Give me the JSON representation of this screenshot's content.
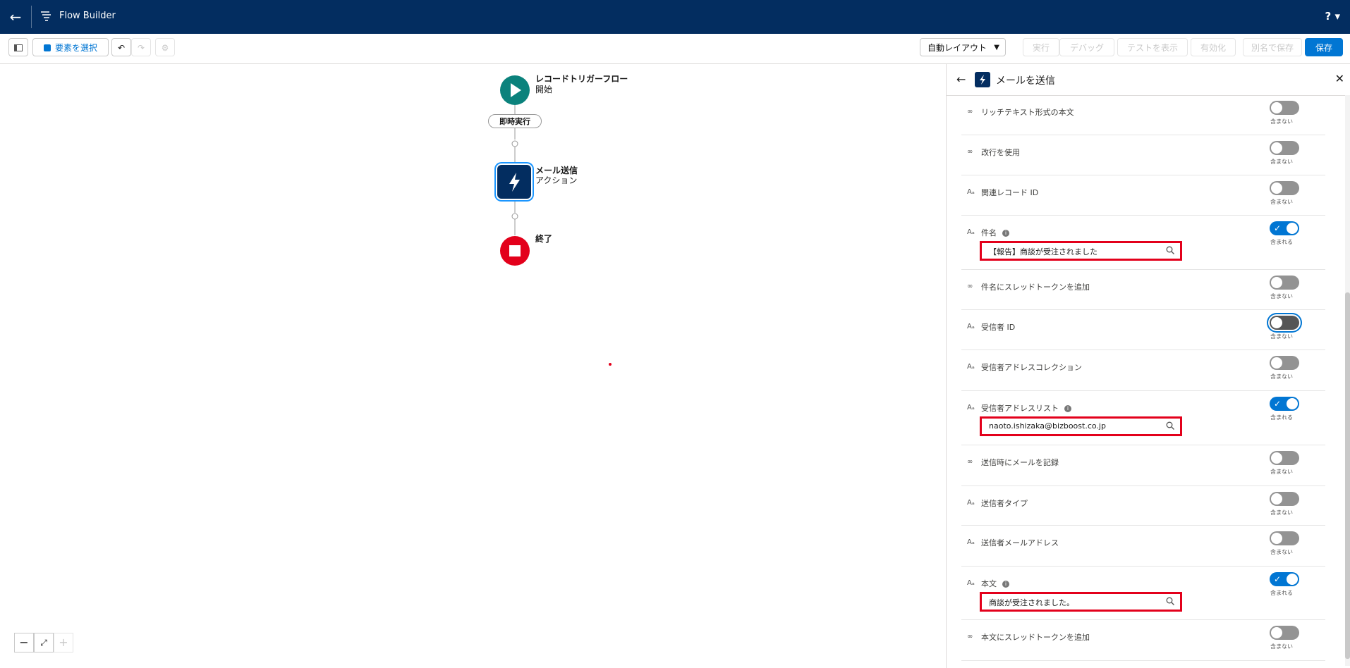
{
  "topbar": {
    "back_icon": "arrow-left-icon",
    "app_icon": "flow-icon",
    "title": "Flow Builder",
    "help_label": "? ▾"
  },
  "toolbar": {
    "select_elements": "要素を選択",
    "auto_layout": "自動レイアウト",
    "run": "実行",
    "debug": "デバッグ",
    "view_tests": "テストを表示",
    "activate": "有効化",
    "save_as": "別名で保存",
    "save": "保存"
  },
  "canvas": {
    "start_title": "レコードトリガーフロー",
    "start_sub": "開始",
    "path_label": "即時実行",
    "action_title": "メール送信",
    "action_sub": "アクション",
    "end_title": "終了",
    "zoom_out": "−",
    "fit": "⤢",
    "zoom_in": "+"
  },
  "panel": {
    "title": "メールを送信",
    "rows": [
      {
        "label": "リッチテキスト形式の本文",
        "on": false,
        "status": "含まない"
      },
      {
        "label": "改行を使用",
        "on": false,
        "status": "含まない"
      },
      {
        "label": "関連レコード ID",
        "on": false,
        "status": "含まない"
      },
      {
        "label": "件名",
        "on": true,
        "status": "含まれる",
        "value": "【報告】商談が受注されました"
      },
      {
        "label": "件名にスレッドトークンを追加",
        "on": false,
        "status": "含まない"
      },
      {
        "label": "受信者 ID",
        "on": false,
        "status": "含まない"
      },
      {
        "label": "受信者アドレスコレクション",
        "on": false,
        "status": "含まない"
      },
      {
        "label": "受信者アドレスリスト",
        "on": true,
        "status": "含まれる",
        "value": "naoto.ishizaka@bizboost.co.jp"
      },
      {
        "label": "送信時にメールを記録",
        "on": false,
        "status": "含まない"
      },
      {
        "label": "送信者タイプ",
        "on": false,
        "status": "含まない"
      },
      {
        "label": "送信者メールアドレス",
        "on": false,
        "status": "含まない"
      },
      {
        "label": "本文",
        "on": true,
        "status": "含まれる",
        "value": "商談が受注されました。"
      },
      {
        "label": "本文にスレッドトークンを追加",
        "on": false,
        "status": "含まない"
      }
    ]
  }
}
